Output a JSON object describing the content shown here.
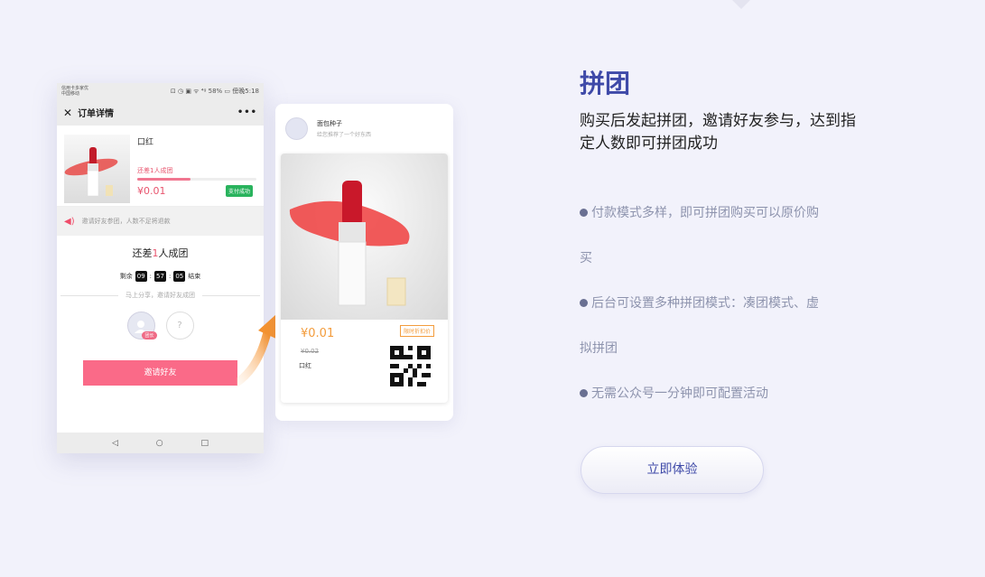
{
  "phone": {
    "status_left_1": "信用卡多家优",
    "status_left_2": "中国移动",
    "status_right": "⊡ ◷ ▣ ᯤ ⁴ᵍ 58% ▭ 傍晚5:18",
    "title": "订单详情",
    "more": "•••",
    "product_name": "口红",
    "lack_text": "还差1人成团",
    "progress": 0.45,
    "price": "¥0.01",
    "paid_badge": "支付成功",
    "notice": "邀请好友参团，人数不足将退款",
    "lack_big_prefix": "还差",
    "lack_big_num": "1",
    "lack_big_suffix": "人成团",
    "timer_prefix": "剩余",
    "timer_h": "09",
    "timer_m": "57",
    "timer_s": "05",
    "timer_suffix": "结束",
    "share_hint": "马上分享，邀请好友成团",
    "leader_tag": "团长",
    "unknown": "?",
    "invite_button": "邀请好友",
    "nav_back": "◁",
    "nav_home": "○",
    "nav_recent": "□"
  },
  "card": {
    "user_name": "面包种子",
    "user_sub": "给您推荐了一个好东西",
    "price": "¥0.01",
    "original_price": "¥0.02",
    "product_name": "口红",
    "limit_tag": "限时折扣价"
  },
  "feature": {
    "title": "拼团",
    "subtitle": "购买后发起拼团，邀请好友参与，达到指定人数即可拼团成功",
    "items": [
      {
        "line1": "付款模式多样，即可拼团购买可以原价购",
        "line2": "买"
      },
      {
        "line1": "后台可设置多种拼团模式：凑团模式、虚",
        "line2": "拟拼团"
      },
      {
        "line1": "无需公众号一分钟即可配置活动"
      }
    ],
    "cta": "立即体验"
  },
  "colors": {
    "accent": "#3f4aa8",
    "pink": "#fa6a88",
    "orange": "#f39c3c",
    "green": "#29b35d",
    "background": "#f2f2fb"
  }
}
